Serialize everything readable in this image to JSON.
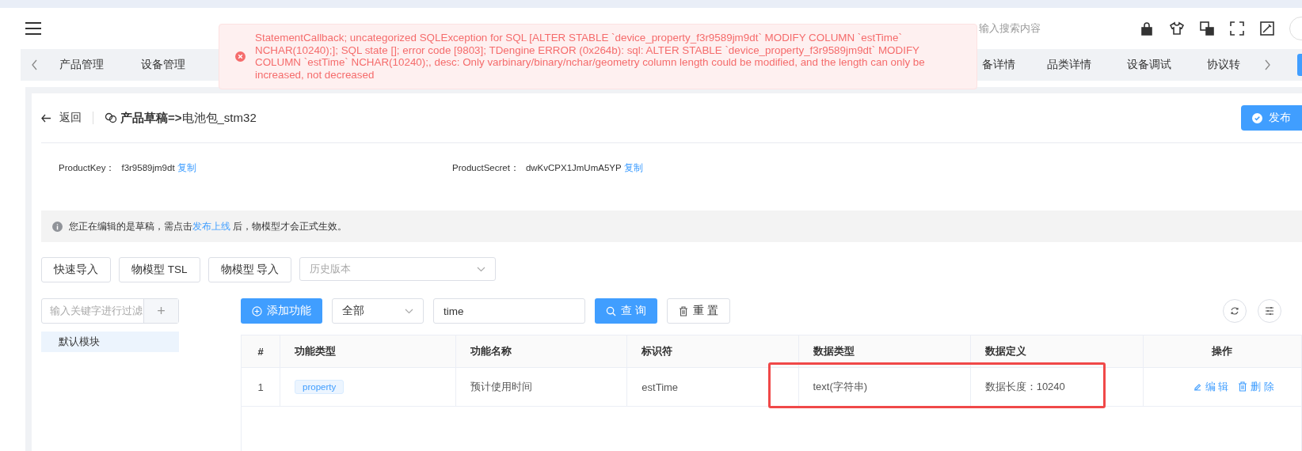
{
  "header": {
    "search_placeholder": "输入搜索内容"
  },
  "tabs": [
    {
      "label": "产品管理",
      "selected": false
    },
    {
      "label": "设备管理",
      "selected": false
    },
    {
      "label": "备详情",
      "selected": false
    },
    {
      "label": "品类详情",
      "selected": false
    },
    {
      "label": "设备调试",
      "selected": false
    },
    {
      "label": "协议转",
      "selected": false
    }
  ],
  "toast": {
    "message": "StatementCallback; uncategorized SQLException for SQL [ALTER STABLE `device_property_f3r9589jm9dt` MODIFY COLUMN `estTime` NCHAR(10240);]; SQL state []; error code [9803]; TDengine ERROR (0x264b): sql: ALTER STABLE `device_property_f3r9589jm9dt` MODIFY COLUMN `estTime` NCHAR(10240);, desc: Only varbinary/binary/nchar/geometry column length could be modified, and the length can only be increased, not decreased"
  },
  "page": {
    "back": "返回",
    "title_prefix": "产品草稿=>",
    "title": "电池包_stm32",
    "publish": "发布"
  },
  "keys": [
    {
      "label": "ProductKey：",
      "value": "f3r9589jm9dt",
      "copy": "复制"
    },
    {
      "label": "ProductSecret：",
      "value": "dwKvCPX1JmUmA5YP",
      "copy": "复制"
    }
  ],
  "notice": {
    "before": "您正在编辑的是草稿，需点击",
    "link": "发布上线",
    "after": " 后，物模型才会正式生效。"
  },
  "toolbar": {
    "buttons": [
      "快速导入",
      "物模型 TSL",
      "物模型 导入"
    ],
    "version_placeholder": "历史版本"
  },
  "modules": {
    "filter_placeholder": "输入关键字进行过滤",
    "add": "+",
    "items": [
      {
        "label": "默认模块",
        "selected": true
      }
    ]
  },
  "filters": {
    "add": "添加功能",
    "type": "全部",
    "keyword": "time",
    "search": "查 询",
    "reset": "重 置"
  },
  "table": {
    "columns": [
      "#",
      "功能类型",
      "功能名称",
      "标识符",
      "数据类型",
      "数据定义",
      "操作"
    ],
    "rows": [
      {
        "index": "1",
        "type": "property",
        "name": "预计使用时间",
        "identifier": "estTime",
        "data_type": "text(字符串)",
        "definition": "数据长度：10240",
        "actions": [
          "编 辑",
          "删 除"
        ]
      }
    ]
  }
}
